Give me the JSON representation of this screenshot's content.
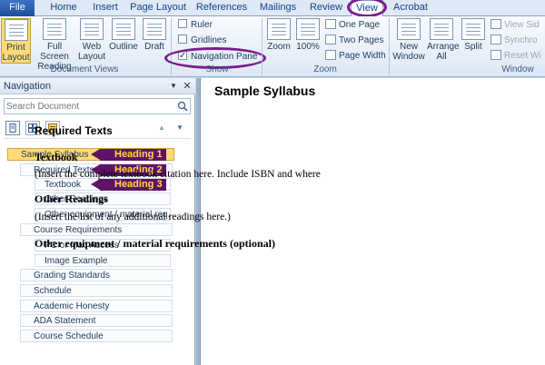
{
  "tabs": [
    "File",
    "Home",
    "Insert",
    "Page Layout",
    "References",
    "Mailings",
    "Review",
    "View",
    "Acrobat"
  ],
  "ribbon": {
    "document_views": {
      "label": "Document Views",
      "print_layout": "Print Layout",
      "full_screen_reading": "Full Screen Reading",
      "web_layout": "Web Layout",
      "outline": "Outline",
      "draft": "Draft"
    },
    "show": {
      "label": "Show",
      "ruler": "Ruler",
      "gridlines": "Gridlines",
      "navigation_pane": "Navigation Pane"
    },
    "zoom": {
      "label": "Zoom",
      "zoom": "Zoom",
      "hundred": "100%",
      "one_page": "One Page",
      "two_pages": "Two Pages",
      "page_width": "Page Width"
    },
    "window": {
      "label": "Window",
      "new_window": "New Window",
      "arrange_all": "Arrange All",
      "split": "Split",
      "view_side": "View Sid",
      "synchronous": "Synchro",
      "reset_window": "Reset Wi"
    }
  },
  "navigation": {
    "title": "Navigation",
    "search_placeholder": "Search Document",
    "items": [
      "Sample Syllabus",
      "Required Texts",
      "Textbook",
      "Other Readings",
      "Other equipment / material req...",
      "Course Requirements",
      "PC or Mac Access",
      "Image Example",
      "Grading Standards",
      "Schedule",
      "Academic Honesty",
      "ADA Statement",
      "Course Schedule"
    ],
    "annotations": [
      "Heading 1",
      "Heading 2",
      "Heading 3"
    ]
  },
  "document": {
    "title": "Sample Syllabus",
    "h1": "Required Texts",
    "h2_textbook": "Textbook",
    "p_textbook": "(Insert the complete textbook citation here.  Include ISBN and where",
    "h2_other": "Other Readings",
    "p_other": "(Insert the list of any additional readings here.)",
    "h2_equipment": "Other equipment / material requirements (optional)"
  },
  "colors": {
    "annotation_purple": "#7b1b8c",
    "annotation_fill": "#5e1466",
    "annotation_text": "#ffd94a",
    "selected_item": "#ffdb75"
  }
}
